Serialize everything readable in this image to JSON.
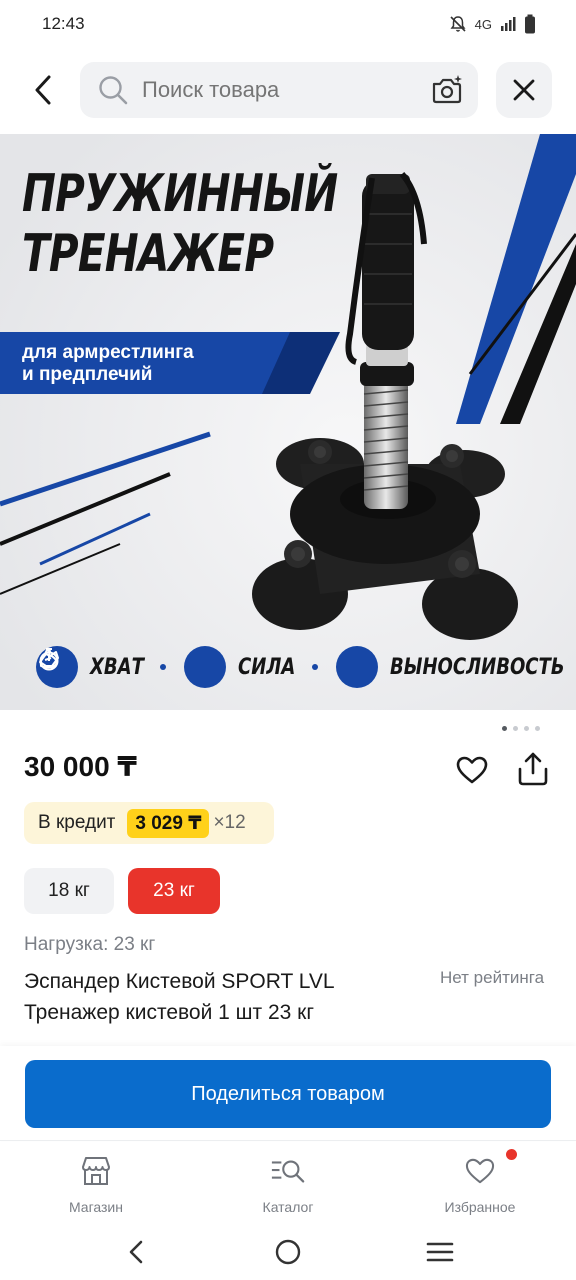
{
  "status_bar": {
    "time": "12:43",
    "network": "4G"
  },
  "search": {
    "placeholder": "Поиск товара"
  },
  "hero": {
    "title_line1": "ПРУЖИННЫЙ",
    "title_line2": "ТРЕНАЖЕР",
    "subtitle_line1": "для армрестлинга",
    "subtitle_line2": "и предплечий",
    "features": [
      "ХВАТ",
      "СИЛА",
      "ВЫНОСЛИВОСТЬ"
    ]
  },
  "gallery": {
    "page_count": 4,
    "current_page": 1
  },
  "product": {
    "price": "30 000 ₸",
    "credit_label": "В кредит",
    "credit_amount": "3 029 ₸",
    "credit_multiplier": "×12",
    "options": [
      {
        "label": "18 кг",
        "selected": false
      },
      {
        "label": "23 кг",
        "selected": true
      }
    ],
    "load": "Нагрузка: 23 кг",
    "title": "Эспандер Кистевой SPORT LVL Тренажер кистевой 1 шт 23 кг",
    "rating": "Нет рейтинга"
  },
  "cta": {
    "label": "Поделиться товаром"
  },
  "bottom_nav": [
    {
      "label": "Магазин",
      "icon": "store-icon"
    },
    {
      "label": "Каталог",
      "icon": "catalog-search-icon"
    },
    {
      "label": "Избранное",
      "icon": "heart-icon",
      "badge": true
    }
  ],
  "colors": {
    "accent_blue": "#0a6ccc",
    "selected_red": "#e8342b",
    "credit_yellow": "#ffd11a",
    "brand_blue": "#1747a6"
  }
}
